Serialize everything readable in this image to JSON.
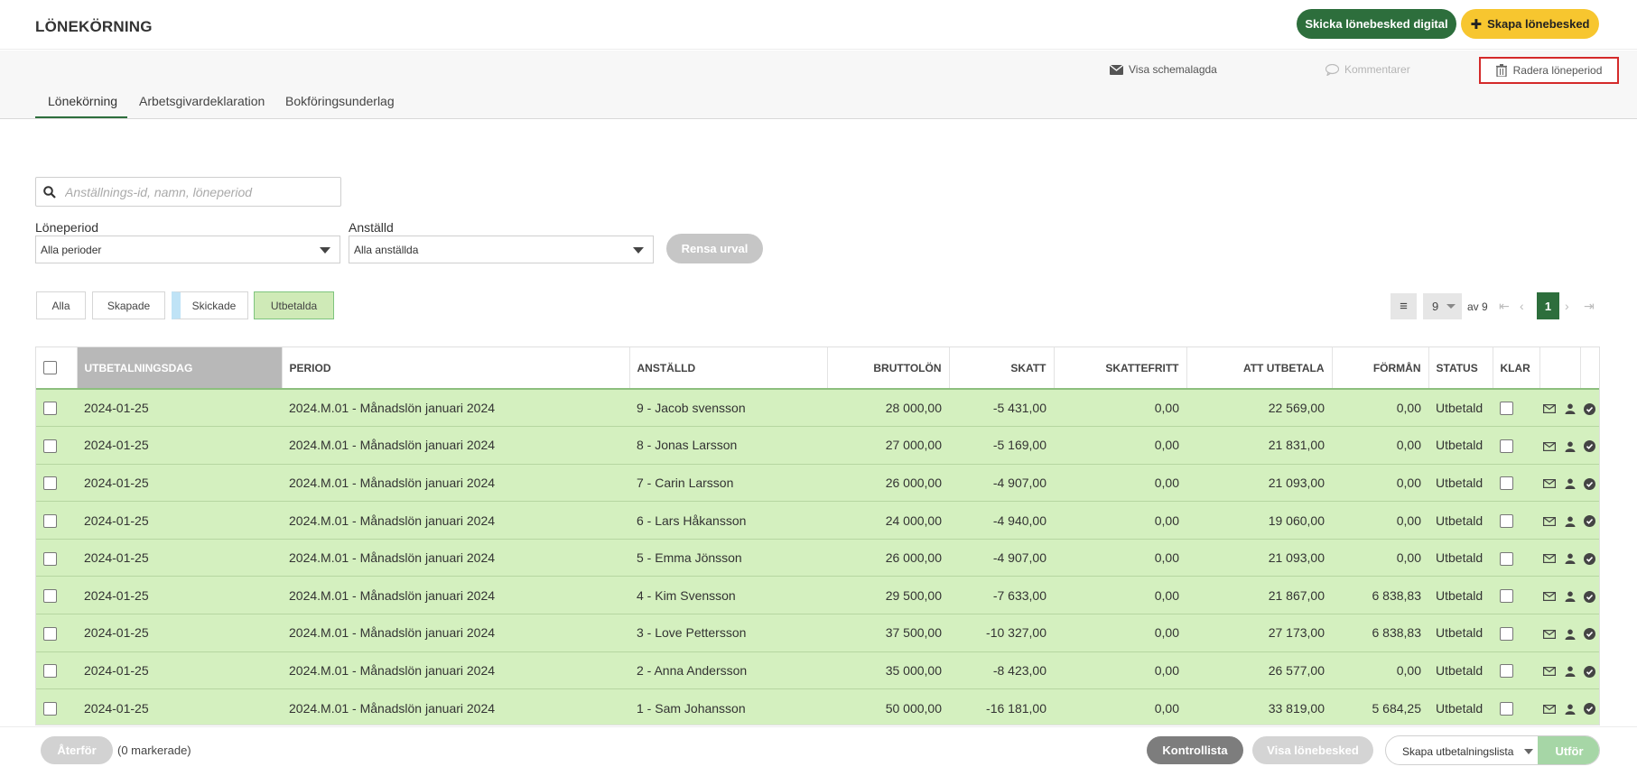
{
  "header": {
    "title": "LÖNEKÖRNING",
    "send_digital_label": "Skicka lönebesked digital",
    "create_label": "Skapa lönebesked"
  },
  "actions": {
    "scheduled_label": "Visa schemalagda",
    "comments_label": "Kommentarer",
    "delete_label": "Radera löneperiod"
  },
  "tabs": [
    {
      "label": "Lönekörning",
      "active": true
    },
    {
      "label": "Arbetsgivardeklaration",
      "active": false
    },
    {
      "label": "Bokföringsunderlag",
      "active": false
    }
  ],
  "search": {
    "placeholder": "Anställnings-id, namn, löneperiod"
  },
  "filters": {
    "period_label": "Löneperiod",
    "period_value": "Alla perioder",
    "employee_label": "Anställd",
    "employee_value": "Alla anställda",
    "clear_label": "Rensa urval"
  },
  "status_buttons": [
    "Alla",
    "Skapade",
    "Skickade",
    "Utbetalda"
  ],
  "pager": {
    "page_size": "9",
    "of_label": "av 9",
    "current": "1"
  },
  "table": {
    "columns": [
      "UTBETALNINGSDAG",
      "PERIOD",
      "ANSTÄLLD",
      "BRUTTOLÖN",
      "SKATT",
      "SKATTEFRITT",
      "ATT UTBETALA",
      "FÖRMÅN",
      "STATUS",
      "KLAR"
    ],
    "rows": [
      {
        "date": "2024-01-25",
        "period": "2024.M.01 - Månadslön januari 2024",
        "employee": "9 - Jacob svensson",
        "gross": "28 000,00",
        "tax": "-5 431,00",
        "taxfree": "0,00",
        "pay": "22 569,00",
        "benefit": "0,00",
        "status": "Utbetald"
      },
      {
        "date": "2024-01-25",
        "period": "2024.M.01 - Månadslön januari 2024",
        "employee": "8 - Jonas Larsson",
        "gross": "27 000,00",
        "tax": "-5 169,00",
        "taxfree": "0,00",
        "pay": "21 831,00",
        "benefit": "0,00",
        "status": "Utbetald"
      },
      {
        "date": "2024-01-25",
        "period": "2024.M.01 - Månadslön januari 2024",
        "employee": "7 - Carin Larsson",
        "gross": "26 000,00",
        "tax": "-4 907,00",
        "taxfree": "0,00",
        "pay": "21 093,00",
        "benefit": "0,00",
        "status": "Utbetald"
      },
      {
        "date": "2024-01-25",
        "period": "2024.M.01 - Månadslön januari 2024",
        "employee": "6 - Lars Håkansson",
        "gross": "24 000,00",
        "tax": "-4 940,00",
        "taxfree": "0,00",
        "pay": "19 060,00",
        "benefit": "0,00",
        "status": "Utbetald"
      },
      {
        "date": "2024-01-25",
        "period": "2024.M.01 - Månadslön januari 2024",
        "employee": "5 - Emma Jönsson",
        "gross": "26 000,00",
        "tax": "-4 907,00",
        "taxfree": "0,00",
        "pay": "21 093,00",
        "benefit": "0,00",
        "status": "Utbetald"
      },
      {
        "date": "2024-01-25",
        "period": "2024.M.01 - Månadslön januari 2024",
        "employee": "4 - Kim Svensson",
        "gross": "29 500,00",
        "tax": "-7 633,00",
        "taxfree": "0,00",
        "pay": "21 867,00",
        "benefit": "6 838,83",
        "status": "Utbetald"
      },
      {
        "date": "2024-01-25",
        "period": "2024.M.01 - Månadslön januari 2024",
        "employee": "3 - Love Pettersson",
        "gross": "37 500,00",
        "tax": "-10 327,00",
        "taxfree": "0,00",
        "pay": "27 173,00",
        "benefit": "6 838,83",
        "status": "Utbetald"
      },
      {
        "date": "2024-01-25",
        "period": "2024.M.01 - Månadslön januari 2024",
        "employee": "2 - Anna Andersson",
        "gross": "35 000,00",
        "tax": "-8 423,00",
        "taxfree": "0,00",
        "pay": "26 577,00",
        "benefit": "0,00",
        "status": "Utbetald"
      },
      {
        "date": "2024-01-25",
        "period": "2024.M.01 - Månadslön januari 2024",
        "employee": "1 - Sam Johansson",
        "gross": "50 000,00",
        "tax": "-16 181,00",
        "taxfree": "0,00",
        "pay": "33 819,00",
        "benefit": "5 684,25",
        "status": "Utbetald"
      }
    ]
  },
  "footer": {
    "revert_label": "Återför",
    "marked_label": "(0 markerade)",
    "control_label": "Kontrollista",
    "show_slip_label": "Visa lönebesked",
    "payout_list_label": "Skapa utbetalningslista",
    "execute_label": "Utför"
  },
  "colors": {
    "accent_green": "#2d6e3c",
    "accent_yellow": "#f7c62f",
    "row_paid": "#d4f0bf",
    "highlight_red": "#d42a2a"
  }
}
